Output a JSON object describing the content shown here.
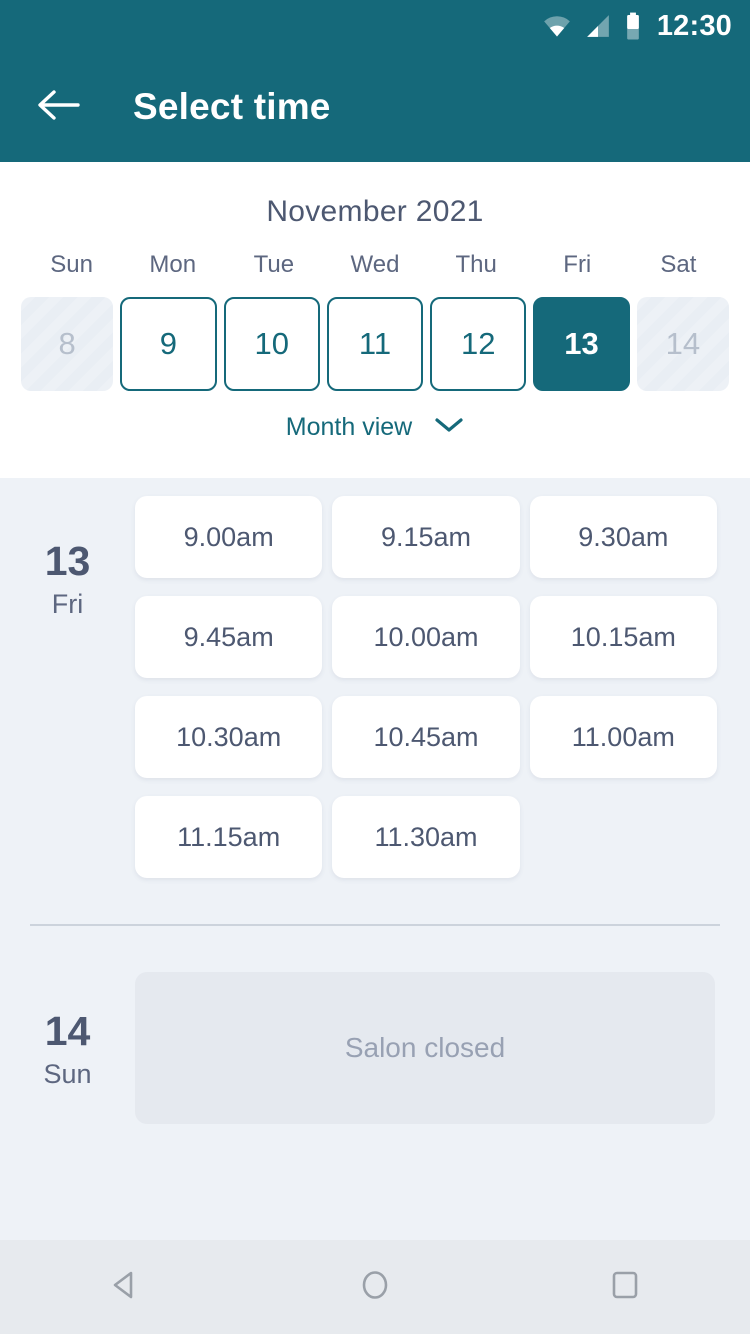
{
  "statusbar": {
    "time": "12:30",
    "icons": [
      "wifi-icon",
      "cellular-signal-icon",
      "battery-icon"
    ]
  },
  "appbar": {
    "back_label": "back-arrow-icon",
    "title": "Select time"
  },
  "calendar": {
    "month_title": "November 2021",
    "weekdays": [
      "Sun",
      "Mon",
      "Tue",
      "Wed",
      "Thu",
      "Fri",
      "Sat"
    ],
    "days": [
      {
        "num": "8",
        "state": "disabled"
      },
      {
        "num": "9",
        "state": "normal"
      },
      {
        "num": "10",
        "state": "normal"
      },
      {
        "num": "11",
        "state": "normal"
      },
      {
        "num": "12",
        "state": "normal"
      },
      {
        "num": "13",
        "state": "selected"
      },
      {
        "num": "14",
        "state": "disabled"
      }
    ],
    "month_view_label": "Month view",
    "chevron": "chevron-down-icon"
  },
  "schedule": [
    {
      "date_number": "13",
      "weekday": "Fri",
      "slots": [
        "9.00am",
        "9.15am",
        "9.30am",
        "9.45am",
        "10.00am",
        "10.15am",
        "10.30am",
        "10.45am",
        "11.00am",
        "11.15am",
        "11.30am"
      ]
    },
    {
      "date_number": "14",
      "weekday": "Sun",
      "closed_message": "Salon closed"
    }
  ],
  "navbar": {
    "back": "nav-back-icon",
    "home": "nav-home-icon",
    "recents": "nav-recents-icon"
  },
  "colors": {
    "accent": "#15697a",
    "background": "#eef2f7",
    "card": "#ffffff",
    "text_primary": "#4d5871",
    "text_muted": "#98a1b3",
    "disabled": "#b6bfcc"
  }
}
